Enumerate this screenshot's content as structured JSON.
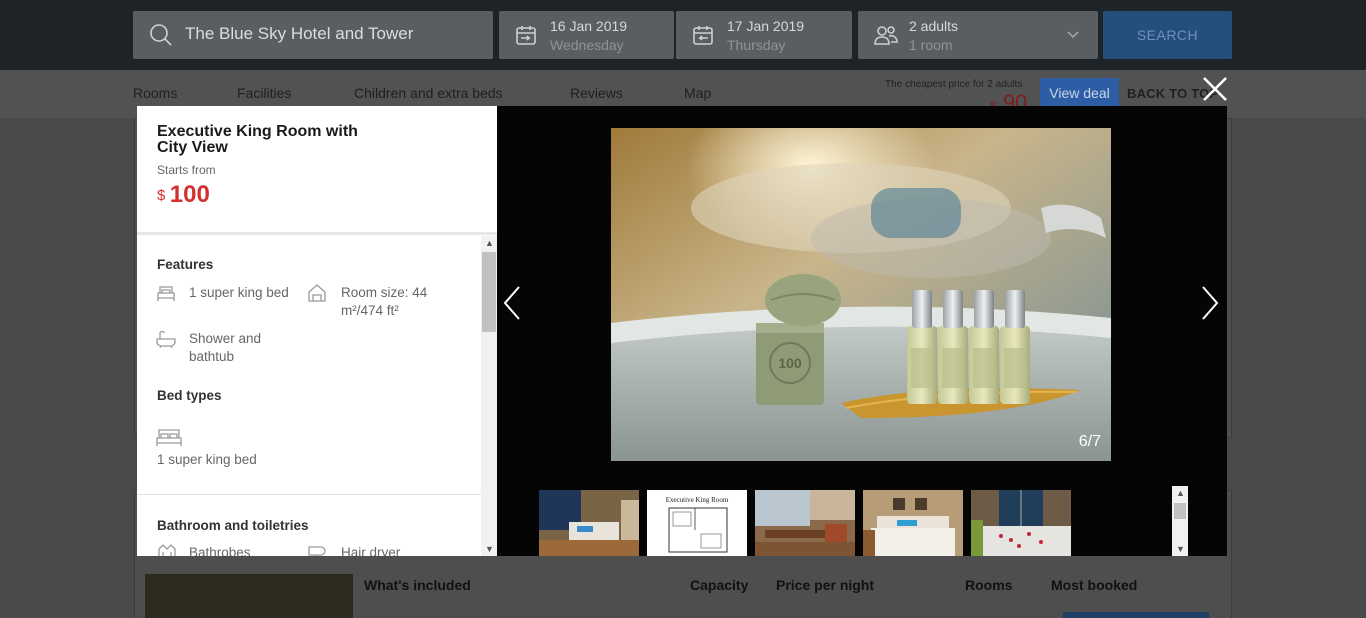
{
  "search": {
    "hotel": "The Blue Sky Hotel and Tower",
    "checkin_date": "16 Jan 2019",
    "checkin_day": "Wednesday",
    "checkout_date": "17 Jan 2019",
    "checkout_day": "Thursday",
    "guests": "2 adults",
    "rooms": "1 room",
    "search_label": "SEARCH"
  },
  "nav": {
    "tabs": [
      "Rooms",
      "Facilities",
      "Children and extra beds",
      "Reviews",
      "Map"
    ],
    "cheapest_text": "The cheapest price for 2 adults",
    "cheapest_currency": "$",
    "cheapest_price": "90",
    "view_deal": "View deal",
    "back_to_top": "BACK TO TOP"
  },
  "background": {
    "headers": [
      "What's included",
      "Capacity",
      "Price per night",
      "Rooms",
      "Most booked"
    ]
  },
  "room_panel": {
    "title": "Executive King Room with City View",
    "starts_from": "Starts from",
    "currency": "$",
    "price": "100",
    "features_title": "Features",
    "features": [
      {
        "icon": "bed-icon",
        "text": "1 super king bed"
      },
      {
        "icon": "room-size-icon",
        "text": "Room size: 44 m²/474 ft²"
      },
      {
        "icon": "bathtub-icon",
        "text": "Shower and bathtub"
      }
    ],
    "bed_types_title": "Bed types",
    "bed_type": "1 super king bed",
    "bathroom_title": "Bathroom and toiletries",
    "bathroom_items": [
      {
        "icon": "bathrobe-icon",
        "text": "Bathrobes"
      },
      {
        "icon": "hair-dryer-icon",
        "text": "Hair dryer"
      }
    ]
  },
  "gallery": {
    "counter": "6/7",
    "thumbnails": [
      "hotel-room-thumbnail",
      "floor-plan-thumbnail",
      "desk-area-thumbnail",
      "bed-thumbnail",
      "bathtub-thumbnail"
    ],
    "floor_plan_caption": "Executive King Room"
  },
  "colors": {
    "price_red": "#d32f2f",
    "brand_blue": "#2d5ea5",
    "overlay": "#050505"
  }
}
